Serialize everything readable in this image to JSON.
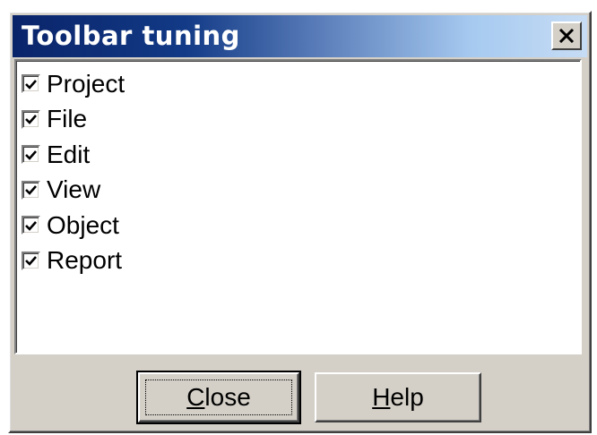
{
  "window": {
    "title": "Toolbar tuning",
    "close_glyph": "✕"
  },
  "list": {
    "items": [
      {
        "label": "Project",
        "checked": true
      },
      {
        "label": "File",
        "checked": true
      },
      {
        "label": "Edit",
        "checked": true
      },
      {
        "label": "View",
        "checked": true
      },
      {
        "label": "Object",
        "checked": true
      },
      {
        "label": "Report",
        "checked": true
      }
    ]
  },
  "buttons": {
    "close": {
      "mnemonic": "C",
      "rest": "lose"
    },
    "help": {
      "mnemonic": "H",
      "rest": "elp"
    }
  },
  "colors": {
    "titlebar_start": "#0a246a",
    "titlebar_end": "#a6caf0",
    "face": "#d4d0c8"
  }
}
